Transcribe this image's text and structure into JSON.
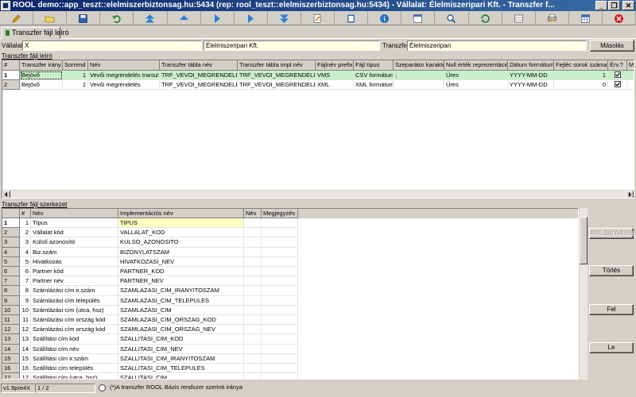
{
  "window": {
    "title": "ROOL demo::app_teszt::elelmiszerbiztonsag.hu:5434 (rep: rool_teszt::elelmiszerbiztonsag.hu:5434) - Vállalat: Élelmiszeripari Kft. - Transzfer f...",
    "minimize_label": "_",
    "restore_label": "❐",
    "close_label": "✕"
  },
  "toolbar": {
    "icons": [
      "edit-icon",
      "open-icon",
      "save-icon",
      "undo-icon",
      "first-icon",
      "prev-icon",
      "next-icon",
      "last-icon",
      "note-icon",
      "export-icon",
      "info-icon",
      "form-icon",
      "search-icon",
      "refresh-icon",
      "list-icon",
      "print-icon",
      "table-icon",
      "grid-icon",
      "close-icon"
    ]
  },
  "tab": {
    "label": "Transzfer fájl leíró"
  },
  "filter": {
    "company_label": "Vállalat:",
    "company_value": "X",
    "company_name_value": "Élelmiszeripari Kft.",
    "transfer_label": "Transzfer:",
    "transfer_value": "Élelmiszeripari",
    "copy_button": "Másolás"
  },
  "upper_grid": {
    "caption": "Transzfer fájl leíró",
    "columns": [
      "#",
      "Transzfer irány",
      "Sorrend",
      "Név",
      "Transzfer tábla név",
      "Transzfer tábla impl.név",
      "Fájlnév prefix",
      "Fájl típus",
      "Szeparátor karakter",
      "Null érték reprezentáció",
      "Dátum formátum",
      "Fejléc sorok száma",
      "Érv.?",
      "M"
    ],
    "rows": [
      {
        "n": "1",
        "direction": "Bejövő",
        "order": "1",
        "name": "Vevői megrendelés transzfer",
        "table": "TRF_VEVOI_MEGRENDELES",
        "impl": "TRF_VEVOI_MEGRENDELES",
        "prefix": "VMS",
        "type": "CSV formátum",
        "sep": ";",
        "null": "Üres",
        "date": "YYYY-MM-DD",
        "headers": "1",
        "valid": true
      },
      {
        "n": "2",
        "direction": "Bejövő",
        "order": "2",
        "name": "Vevői megrendelés",
        "table": "TRF_VEVOI_MEGRENDELES",
        "impl": "TRF_VEVOI_MEGRENDELES",
        "prefix": "XML",
        "type": "XML formátum",
        "sep": "",
        "null": "Üres",
        "date": "YYYY-MM-DD",
        "headers": "0",
        "valid": true
      }
    ]
  },
  "lower_grid": {
    "caption": "Transzfer fájl szerkezet",
    "columns": [
      "#",
      "Név",
      "Implementációs név",
      "Név",
      "Megjegyzés"
    ],
    "rows": [
      {
        "n": "1",
        "seq": "1",
        "name": "Típus",
        "impl": "TIPUS"
      },
      {
        "n": "2",
        "seq": "2",
        "name": "Vállalat kód",
        "impl": "VALLALAT_KOD"
      },
      {
        "n": "3",
        "seq": "3",
        "name": "Külső azonosító",
        "impl": "KULSO_AZONOSITO"
      },
      {
        "n": "4",
        "seq": "4",
        "name": "Biz.szám",
        "impl": "BIZONYLATSZAM"
      },
      {
        "n": "5",
        "seq": "5",
        "name": "Hivatkozás",
        "impl": "HIVATKOZASI_NEV"
      },
      {
        "n": "6",
        "seq": "6",
        "name": "Partner kód",
        "impl": "PARTNER_KOD"
      },
      {
        "n": "7",
        "seq": "7",
        "name": "Partner név",
        "impl": "PARTNER_NEV"
      },
      {
        "n": "8",
        "seq": "8",
        "name": "Számlázási cím ir.szám",
        "impl": "SZAMLAZASI_CIM_IRANYITOSZAM"
      },
      {
        "n": "9",
        "seq": "9",
        "name": "Számlázási cím település",
        "impl": "SZAMLAZASI_CIM_TELEPULES"
      },
      {
        "n": "10",
        "seq": "10",
        "name": "Számlázási cím (utca, hsz)",
        "impl": "SZAMLAZASI_CIM"
      },
      {
        "n": "11",
        "seq": "11",
        "name": "Számlázási cím ország kód",
        "impl": "SZAMLAZASI_CIM_ORSZAG_KOD"
      },
      {
        "n": "12",
        "seq": "12",
        "name": "Számlázási cím ország kód",
        "impl": "SZAMLAZASI_CIM_ORSZAG_NEV"
      },
      {
        "n": "13",
        "seq": "13",
        "name": "Szállítási cím kód",
        "impl": "SZALLITASI_CIM_KOD"
      },
      {
        "n": "14",
        "seq": "14",
        "name": "Szállítási cím név",
        "impl": "SZALLITASI_CIM_NEV"
      },
      {
        "n": "15",
        "seq": "15",
        "name": "Szállítási cím ir.szám",
        "impl": "SZALLITASI_CIM_IRANYITOSZAM"
      },
      {
        "n": "16",
        "seq": "16",
        "name": "Szállítási cím település",
        "impl": "SZALLITASI_CIM_TELEPULES"
      },
      {
        "n": "17",
        "seq": "17",
        "name": "Szállítási cím (utca, hsz)",
        "impl": "SZALLITASI_CIM"
      }
    ]
  },
  "side_buttons": {
    "xml_fill": "XML tag feltöltés",
    "delete": "Törlés",
    "up": "Fel",
    "down": "Le"
  },
  "status": {
    "version": "v1.9pre4X",
    "page": "1 / 2",
    "note": "(*)A transzfer ROOL Bázis rendszer szerinti iránya"
  },
  "colors": {
    "titlebar": "#0a246a",
    "selected_row": "#c8f0c8",
    "input_bg": "#ffffe6",
    "highlight_cell": "#ffffc0"
  }
}
